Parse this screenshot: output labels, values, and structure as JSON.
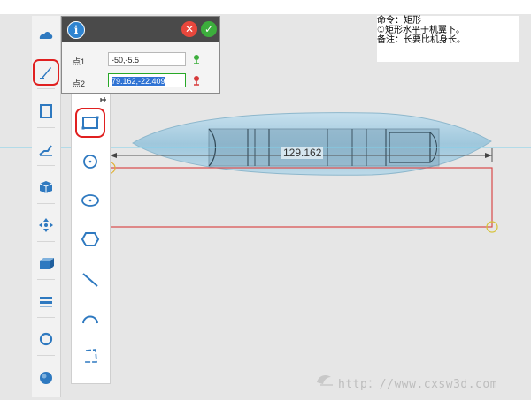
{
  "command_note": {
    "line1": "命令：矩形",
    "line2": "①矩形水平于机翼下。",
    "line3": "备注：长要比机身长。"
  },
  "input_panel": {
    "info_icon_glyph": "i",
    "close_icon_glyph": "✕",
    "confirm_icon_glyph": "✓",
    "point1": {
      "label": "点1",
      "value": "-50,-5.5"
    },
    "point2": {
      "label": "点2",
      "value": "79.162,-22.409"
    }
  },
  "dimension_value": "129.162",
  "watermark": "http：//www.cxsw3d.com",
  "left_toolbar": [
    "cloud-shape-icon",
    "sketch-brush-icon",
    "page-icon",
    "stairs-icon",
    "cube-icon",
    "move-arrows-icon",
    "box-stack-icon",
    "layers-icon",
    "circle-outline-icon",
    "sphere-icon"
  ],
  "sub_toolbar": [
    "rectangle-icon",
    "circle-icon",
    "ellipse-icon",
    "hexagon-icon",
    "line-icon",
    "arc-icon",
    "polygon-icon"
  ],
  "colors": {
    "viewport_bg": "#e6e6e6",
    "rectangle_stroke": "#d84a4a",
    "highlight_red": "#e02020",
    "snap_point": "#d6c23a",
    "fuselage": "#a9cde0"
  }
}
